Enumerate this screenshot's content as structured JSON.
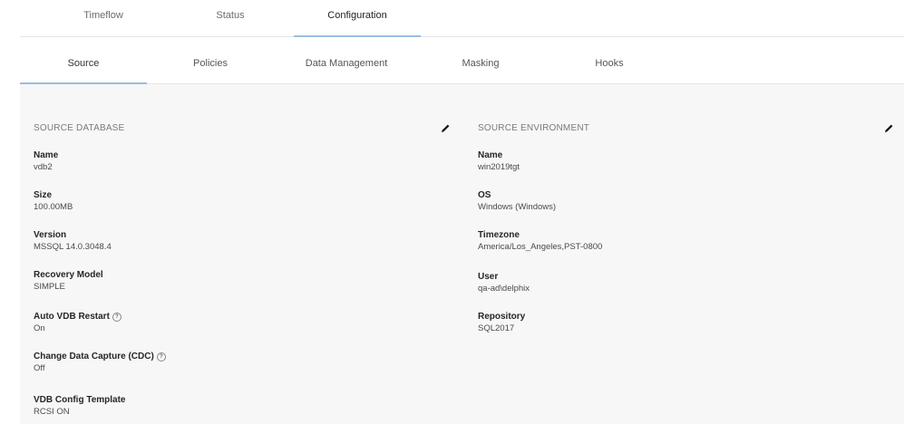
{
  "top_tabs": [
    {
      "label": "Timeflow"
    },
    {
      "label": "Status"
    },
    {
      "label": "Configuration"
    }
  ],
  "sub_tabs": [
    {
      "label": "Source"
    },
    {
      "label": "Policies"
    },
    {
      "label": "Data Management"
    },
    {
      "label": "Masking"
    },
    {
      "label": "Hooks"
    }
  ],
  "active_top_tab": "Configuration",
  "active_sub_tab": "Source",
  "source_database": {
    "title": "SOURCE DATABASE",
    "edit_icon": "pencil-icon",
    "fields": [
      {
        "label": "Name",
        "value": "vdb2"
      },
      {
        "label": "Size",
        "value": "100.00MB"
      },
      {
        "label": "Version",
        "value": "MSSQL 14.0.3048.4"
      },
      {
        "label": "Recovery Model",
        "value": "SIMPLE"
      },
      {
        "label": "Auto VDB Restart",
        "value": "On",
        "help_icon": "help-circle-icon"
      },
      {
        "label": "Change Data Capture (CDC)",
        "value": "Off",
        "help_icon": "help-circle-icon"
      },
      {
        "label": "VDB Config Template",
        "value": "RCSI ON"
      }
    ]
  },
  "source_environment": {
    "title": "SOURCE ENVIRONMENT",
    "edit_icon": "pencil-icon",
    "fields": [
      {
        "label": "Name",
        "value": "win2019tgt"
      },
      {
        "label": "OS",
        "value": "Windows (Windows)"
      },
      {
        "label": "Timezone",
        "value": "America/Los_Angeles,PST-0800"
      },
      {
        "label": "User",
        "value": "qa-ad\\delphix"
      },
      {
        "label": "Repository",
        "value": "SQL2017"
      }
    ]
  },
  "colors": {
    "active_tab_underline": "#9bbde0",
    "panel_background": "#f7f7f7"
  }
}
